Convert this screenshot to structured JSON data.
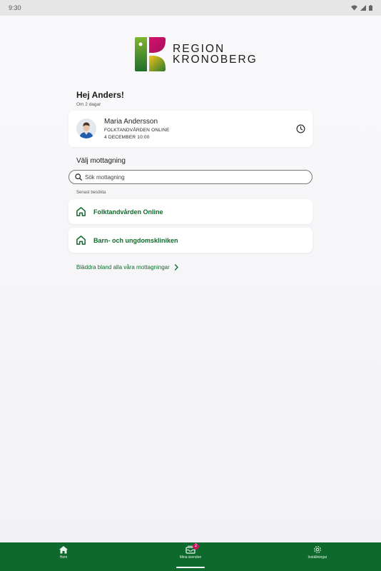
{
  "status_bar": {
    "time": "9:30"
  },
  "logo": {
    "line1": "REGION",
    "line2": "KRONOBERG"
  },
  "greeting": {
    "title": "Hej Anders!",
    "subtitle": "Om 2 dagar"
  },
  "appointment": {
    "name": "Maria Andersson",
    "clinic": "FOLKTANDVÅRDEN ONLINE",
    "date": "4 DECEMBER 10:00"
  },
  "section": {
    "title": "Välj mottagning"
  },
  "search": {
    "placeholder": "Sök mottagning"
  },
  "recent": {
    "label": "Senast besökta",
    "items": [
      {
        "label": "Folktandvården Online"
      },
      {
        "label": "Barn- och ungdomskliniken"
      }
    ]
  },
  "browse": {
    "label": "Bläddra bland alla våra mottagningar"
  },
  "bottom_nav": {
    "items": [
      {
        "label": "Hem",
        "icon": "home-icon"
      },
      {
        "label": "Mina ärenden",
        "icon": "inbox-icon",
        "badge": "2",
        "active": true
      },
      {
        "label": "Inställningar",
        "icon": "gear-icon"
      }
    ]
  },
  "colors": {
    "brand_green": "#0e6a2c",
    "badge": "#c2185b"
  }
}
